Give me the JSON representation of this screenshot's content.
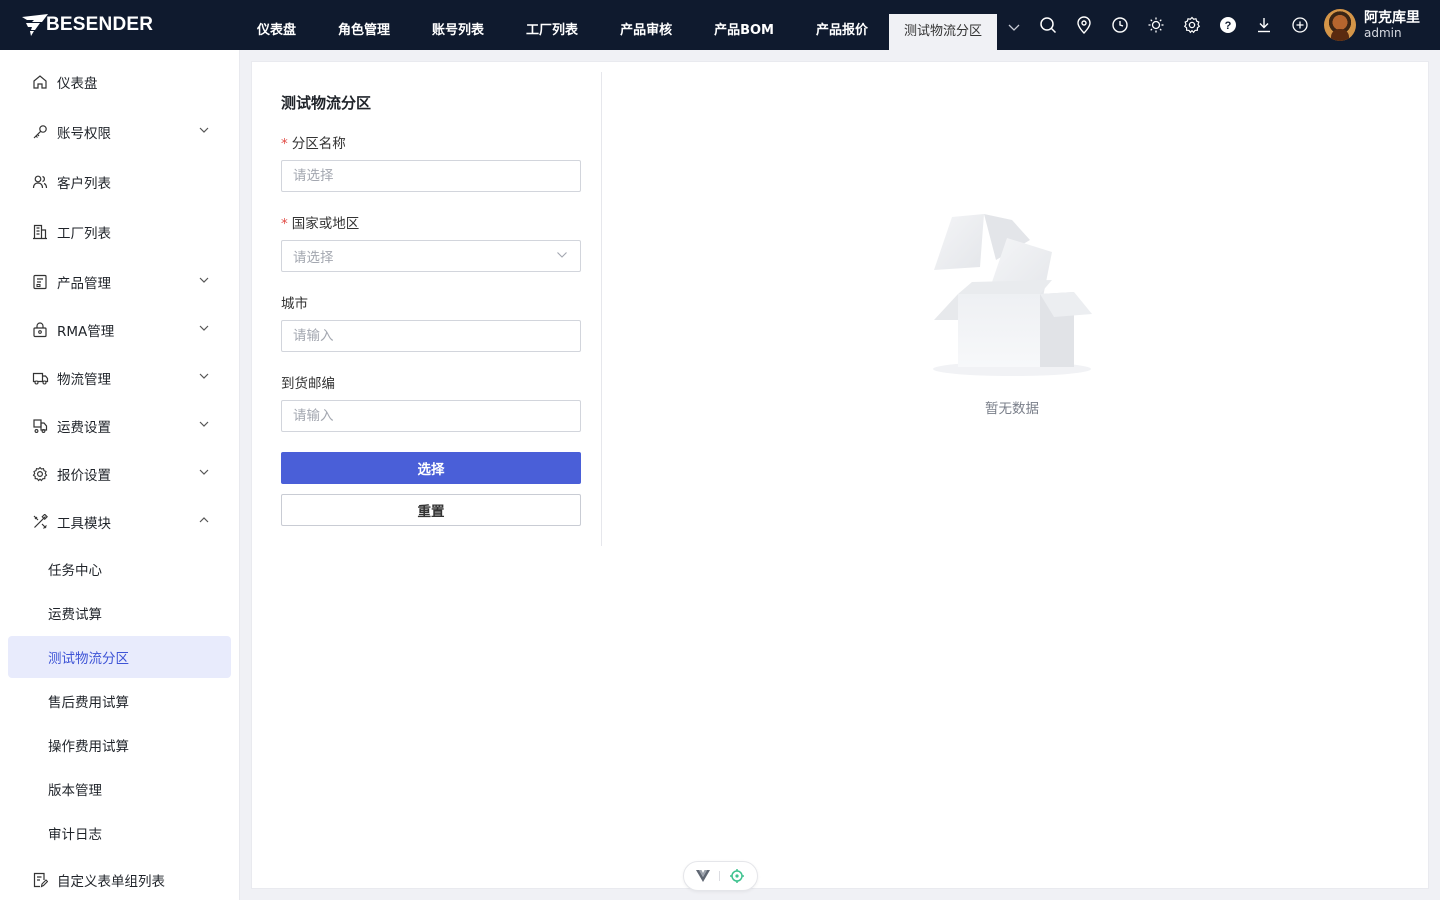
{
  "brand": {
    "logo_text": "BESENDER"
  },
  "topnav": {
    "items": [
      {
        "label": "仪表盘"
      },
      {
        "label": "角色管理"
      },
      {
        "label": "账号列表"
      },
      {
        "label": "工厂列表"
      },
      {
        "label": "产品审核"
      },
      {
        "label": "产品BOM"
      },
      {
        "label": "产品报价"
      },
      {
        "label": "测试物流分区"
      }
    ],
    "active_index": 7,
    "tools": [
      "search-icon",
      "location-icon",
      "clock-icon",
      "sun-icon",
      "settings-icon",
      "help-icon",
      "download-icon",
      "add-circle-icon"
    ]
  },
  "user": {
    "name": "阿克库里",
    "role": "admin"
  },
  "sidebar": {
    "items": [
      {
        "label": "仪表盘",
        "icon": "home-icon",
        "expandable": false
      },
      {
        "label": "账号权限",
        "icon": "key-icon",
        "expandable": true
      },
      {
        "label": "客户列表",
        "icon": "users-icon",
        "expandable": false
      },
      {
        "label": "工厂列表",
        "icon": "building-icon",
        "expandable": false
      },
      {
        "label": "产品管理",
        "icon": "product-icon",
        "expandable": true
      },
      {
        "label": "RMA管理",
        "icon": "lock-box-icon",
        "expandable": true
      },
      {
        "label": "物流管理",
        "icon": "truck-icon",
        "expandable": true
      },
      {
        "label": "运费设置",
        "icon": "freight-icon",
        "expandable": true
      },
      {
        "label": "报价设置",
        "icon": "gear-icon",
        "expandable": true
      },
      {
        "label": "工具模块",
        "icon": "tools-icon",
        "expandable": true,
        "expanded": true
      },
      {
        "label": "自定义表单组列表",
        "icon": "form-icon",
        "expandable": false
      }
    ],
    "tool_subitems": [
      {
        "label": "任务中心"
      },
      {
        "label": "运费试算"
      },
      {
        "label": "测试物流分区",
        "active": true
      },
      {
        "label": "售后费用试算"
      },
      {
        "label": "操作费用试算"
      },
      {
        "label": "版本管理"
      },
      {
        "label": "审计日志"
      }
    ]
  },
  "form": {
    "title": "测试物流分区",
    "required_mark": "*",
    "zone_name": {
      "label": "分区名称",
      "placeholder": "请选择"
    },
    "country": {
      "label": "国家或地区",
      "placeholder": "请选择"
    },
    "city": {
      "label": "城市",
      "placeholder": "请输入"
    },
    "zip": {
      "label": "到货邮编",
      "placeholder": "请输入"
    },
    "submit_label": "选择",
    "reset_label": "重置"
  },
  "result": {
    "empty_text": "暂无数据"
  },
  "colors": {
    "topbar": "#0f1a2e",
    "primary": "#4a5fd8",
    "active_bg": "#e8ebfc",
    "required": "#e14a44"
  }
}
